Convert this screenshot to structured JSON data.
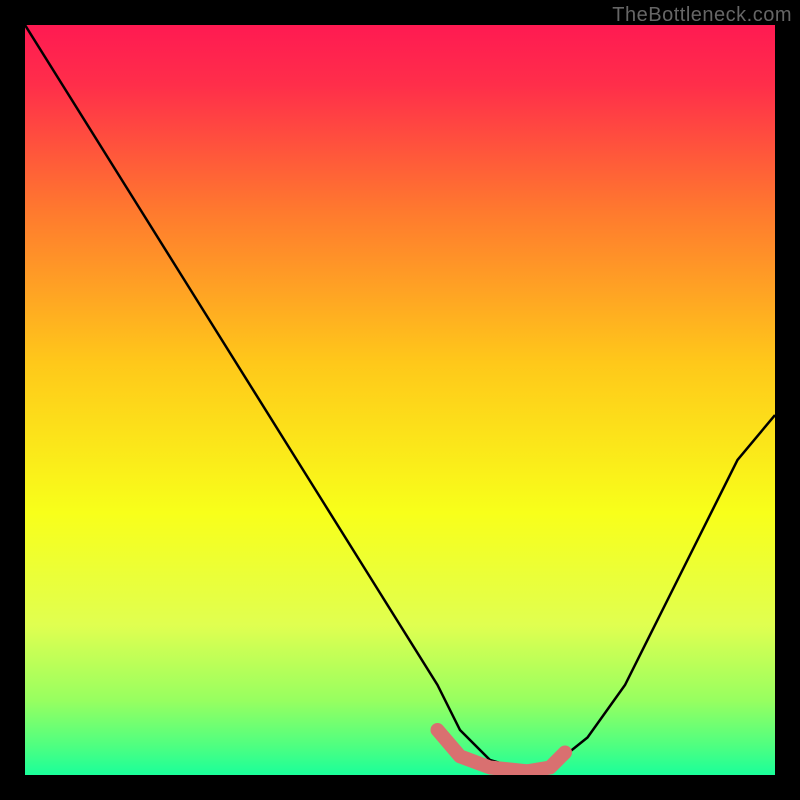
{
  "watermark": "TheBottleneck.com",
  "chart_data": {
    "type": "line",
    "title": "",
    "xlabel": "",
    "ylabel": "",
    "xlim": [
      0,
      100
    ],
    "ylim": [
      0,
      100
    ],
    "series": [
      {
        "name": "bottleneck-curve",
        "x": [
          0,
          5,
          10,
          15,
          20,
          25,
          30,
          35,
          40,
          45,
          50,
          55,
          58,
          62,
          67,
          70,
          75,
          80,
          85,
          90,
          95,
          100
        ],
        "values": [
          100,
          92,
          84,
          76,
          68,
          60,
          52,
          44,
          36,
          28,
          20,
          12,
          6,
          2,
          0.5,
          1,
          5,
          12,
          22,
          32,
          42,
          48
        ],
        "color": "#000000"
      },
      {
        "name": "highlight-zone",
        "x": [
          55,
          58,
          62,
          67,
          70,
          72
        ],
        "values": [
          6,
          2.5,
          1,
          0.5,
          1,
          3
        ],
        "color": "#d97070"
      }
    ],
    "gradient": {
      "stops": [
        {
          "offset": 0.0,
          "color": "#ff1a52"
        },
        {
          "offset": 0.08,
          "color": "#ff2e4a"
        },
        {
          "offset": 0.25,
          "color": "#ff7a2e"
        },
        {
          "offset": 0.45,
          "color": "#ffc81a"
        },
        {
          "offset": 0.65,
          "color": "#f8ff1a"
        },
        {
          "offset": 0.8,
          "color": "#e0ff50"
        },
        {
          "offset": 0.9,
          "color": "#98ff60"
        },
        {
          "offset": 0.96,
          "color": "#50ff80"
        },
        {
          "offset": 1.0,
          "color": "#1aff9a"
        }
      ]
    }
  }
}
